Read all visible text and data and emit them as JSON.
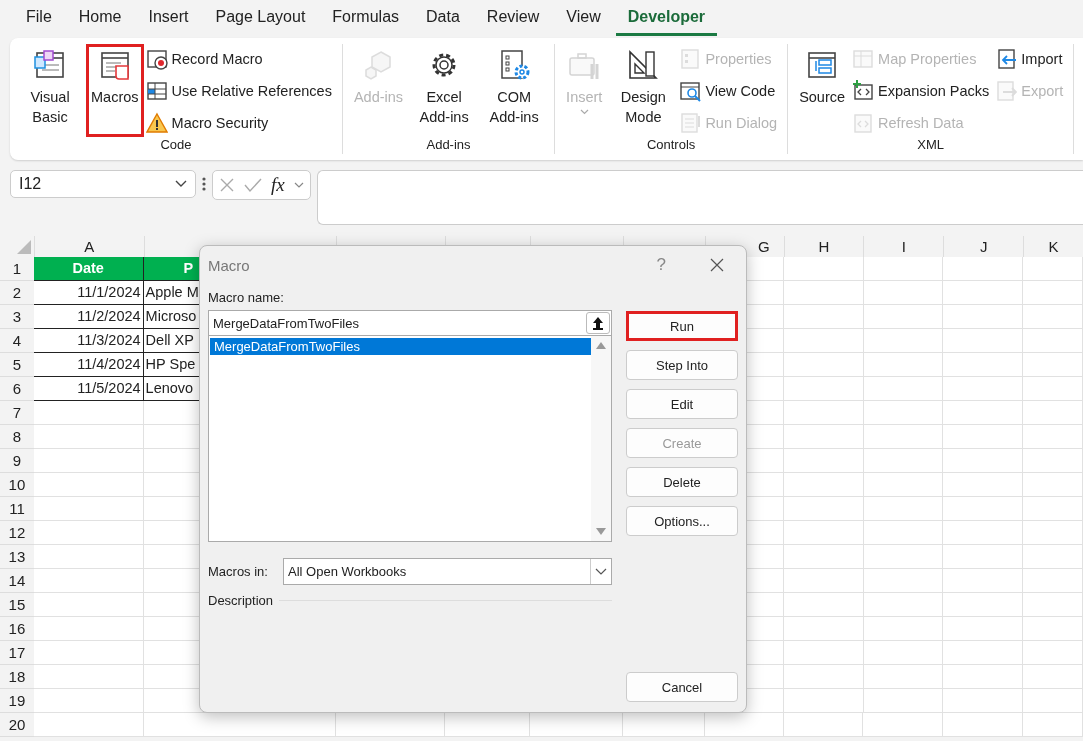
{
  "menu_tabs": [
    {
      "label": "File",
      "selected": false
    },
    {
      "label": "Home",
      "selected": false
    },
    {
      "label": "Insert",
      "selected": false
    },
    {
      "label": "Page Layout",
      "selected": false
    },
    {
      "label": "Formulas",
      "selected": false
    },
    {
      "label": "Data",
      "selected": false
    },
    {
      "label": "Review",
      "selected": false
    },
    {
      "label": "View",
      "selected": false
    },
    {
      "label": "Developer",
      "selected": true
    }
  ],
  "ribbon_groups": [
    {
      "label": "Code",
      "items": [
        {
          "kind": "large",
          "label": "Visual Basic",
          "disabled": false,
          "highlighted": false
        },
        {
          "kind": "large",
          "label": "Macros",
          "disabled": false,
          "highlighted": true
        },
        {
          "kind": "stack",
          "items": [
            {
              "label": "Record Macro",
              "disabled": false
            },
            {
              "label": "Use Relative References",
              "disabled": false
            },
            {
              "label": "Macro Security",
              "disabled": false
            }
          ]
        }
      ]
    },
    {
      "label": "Add-ins",
      "items": [
        {
          "kind": "large",
          "label": "Add-ins",
          "disabled": true,
          "highlighted": false
        },
        {
          "kind": "large",
          "label": "Excel Add-ins",
          "disabled": false,
          "highlighted": false
        },
        {
          "kind": "large",
          "label": "COM Add-ins",
          "disabled": false,
          "highlighted": false
        }
      ]
    },
    {
      "label": "Controls",
      "items": [
        {
          "kind": "large",
          "label": "Insert",
          "disabled": true,
          "highlighted": false,
          "dropdown": true
        },
        {
          "kind": "large",
          "label": "Design Mode",
          "disabled": false,
          "highlighted": false
        },
        {
          "kind": "stack",
          "items": [
            {
              "label": "Properties",
              "disabled": true
            },
            {
              "label": "View Code",
              "disabled": false
            },
            {
              "label": "Run Dialog",
              "disabled": true
            }
          ]
        }
      ]
    },
    {
      "label": "XML",
      "items": [
        {
          "kind": "large",
          "label": "Source",
          "disabled": false,
          "highlighted": false
        },
        {
          "kind": "stack",
          "items": [
            {
              "label": "Map Properties",
              "disabled": true
            },
            {
              "label": "Expansion Packs",
              "disabled": false
            },
            {
              "label": "Refresh Data",
              "disabled": true
            }
          ]
        },
        {
          "kind": "stack",
          "items": [
            {
              "label": "Import",
              "disabled": false
            },
            {
              "label": "Export",
              "disabled": true
            }
          ]
        }
      ]
    }
  ],
  "name_box": "I12",
  "function_button": "fx",
  "columns": [
    {
      "label": "A"
    },
    {},
    {},
    {},
    {},
    {},
    {
      "label": "G"
    },
    {
      "label": "H"
    },
    {
      "label": "I"
    },
    {
      "label": "J"
    },
    {
      "label": "K"
    }
  ],
  "rows": [
    {
      "label": "1",
      "kind": "header",
      "cells": [
        "Date",
        "P"
      ]
    },
    {
      "label": "2",
      "kind": "data",
      "cells": [
        "11/1/2024",
        "Apple M"
      ]
    },
    {
      "label": "3",
      "kind": "data",
      "cells": [
        "11/2/2024",
        "Microso"
      ]
    },
    {
      "label": "4",
      "kind": "data",
      "cells": [
        "11/3/2024",
        "Dell XP"
      ]
    },
    {
      "label": "5",
      "kind": "data",
      "cells": [
        "11/4/2024",
        "HP Spe"
      ]
    },
    {
      "label": "6",
      "kind": "data",
      "cells": [
        "11/5/2024",
        "Lenovo"
      ]
    },
    {
      "label": "7",
      "kind": "empty"
    },
    {
      "label": "8",
      "kind": "empty"
    },
    {
      "label": "9",
      "kind": "empty"
    },
    {
      "label": "10",
      "kind": "empty"
    },
    {
      "label": "11",
      "kind": "empty"
    },
    {
      "label": "12",
      "kind": "empty"
    },
    {
      "label": "13",
      "kind": "empty"
    },
    {
      "label": "14",
      "kind": "empty"
    },
    {
      "label": "15",
      "kind": "empty"
    },
    {
      "label": "16",
      "kind": "empty"
    },
    {
      "label": "17",
      "kind": "empty"
    },
    {
      "label": "18",
      "kind": "empty"
    },
    {
      "label": "19",
      "kind": "empty"
    },
    {
      "label": "20",
      "kind": "empty"
    }
  ],
  "dialog": {
    "title": "Macro",
    "help": "?",
    "name_label": "Macro name:",
    "name_value": "MergeDataFromTwoFiles",
    "macros": [
      {
        "label": "MergeDataFromTwoFiles",
        "selected": true
      }
    ],
    "macros_in_label": "Macros in:",
    "macros_in_value": "All Open Workbooks",
    "description_label": "Description",
    "buttons": [
      {
        "label": "Run",
        "disabled": false,
        "highlighted": true
      },
      {
        "label": "Step Into",
        "disabled": false,
        "highlighted": false
      },
      {
        "label": "Edit",
        "disabled": false,
        "highlighted": false
      },
      {
        "label": "Create",
        "disabled": true,
        "highlighted": false
      },
      {
        "label": "Delete",
        "disabled": false,
        "highlighted": false
      },
      {
        "label": "Options...",
        "disabled": false,
        "highlighted": false
      }
    ],
    "cancel": "Cancel"
  }
}
